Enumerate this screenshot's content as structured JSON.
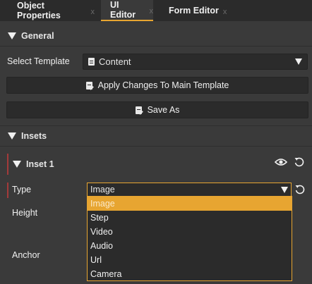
{
  "tabs": [
    {
      "label": "Object Properties",
      "close": "x"
    },
    {
      "label": "UI Editor",
      "close": "x"
    },
    {
      "label": "Form Editor",
      "close": "x"
    }
  ],
  "general": {
    "title": "General",
    "select_template_label": "Select Template",
    "template_value": "Content",
    "apply_button": "Apply Changes To Main Template",
    "save_as_button": "Save As"
  },
  "insets": {
    "title": "Insets",
    "inset1": {
      "title": "Inset 1",
      "type_label": "Type",
      "type_value": "Image",
      "height_label": "Height",
      "anchor_label": "Anchor"
    }
  },
  "type_options": [
    "Image",
    "Step",
    "Video",
    "Audio",
    "Url",
    "Camera"
  ],
  "colors": {
    "accent": "#e7a531",
    "background": "#3a3a3a",
    "panel": "#2b2b2b",
    "marker": "#a33a3a"
  }
}
